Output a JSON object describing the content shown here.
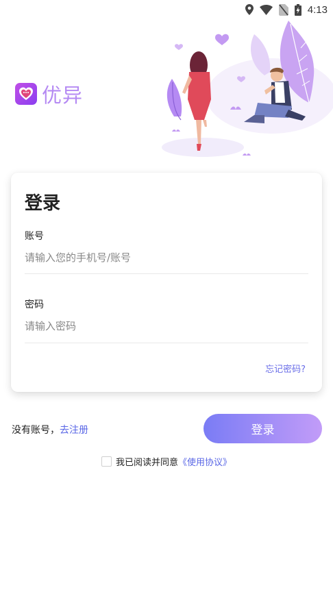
{
  "status_bar": {
    "time": "4:13",
    "icons": [
      "location-icon",
      "wifi-icon",
      "no-sim-icon",
      "battery-charging-icon"
    ]
  },
  "hero": {
    "illustration": "couple-illustration"
  },
  "app": {
    "name": "优异",
    "logo_icon": "heart-chat-icon",
    "brand_color": "#b58af3"
  },
  "login_card": {
    "title": "登录",
    "account": {
      "label": "账号",
      "value": "",
      "placeholder": "请输入您的手机号/账号"
    },
    "password": {
      "label": "密码",
      "value": "",
      "placeholder": "请输入密码"
    },
    "forgot_password": "忘记密码?"
  },
  "footer": {
    "no_account_text": "没有账号，",
    "register_link": "去注册",
    "login_button": "登录",
    "agreement_checked": false,
    "agreement_text": "我已阅读并同意",
    "terms_link": "《使用协议》"
  },
  "colors": {
    "accent": "#6a6ee8",
    "button_gradient_start": "#7a7cf5",
    "button_gradient_end": "#c29cf8"
  }
}
